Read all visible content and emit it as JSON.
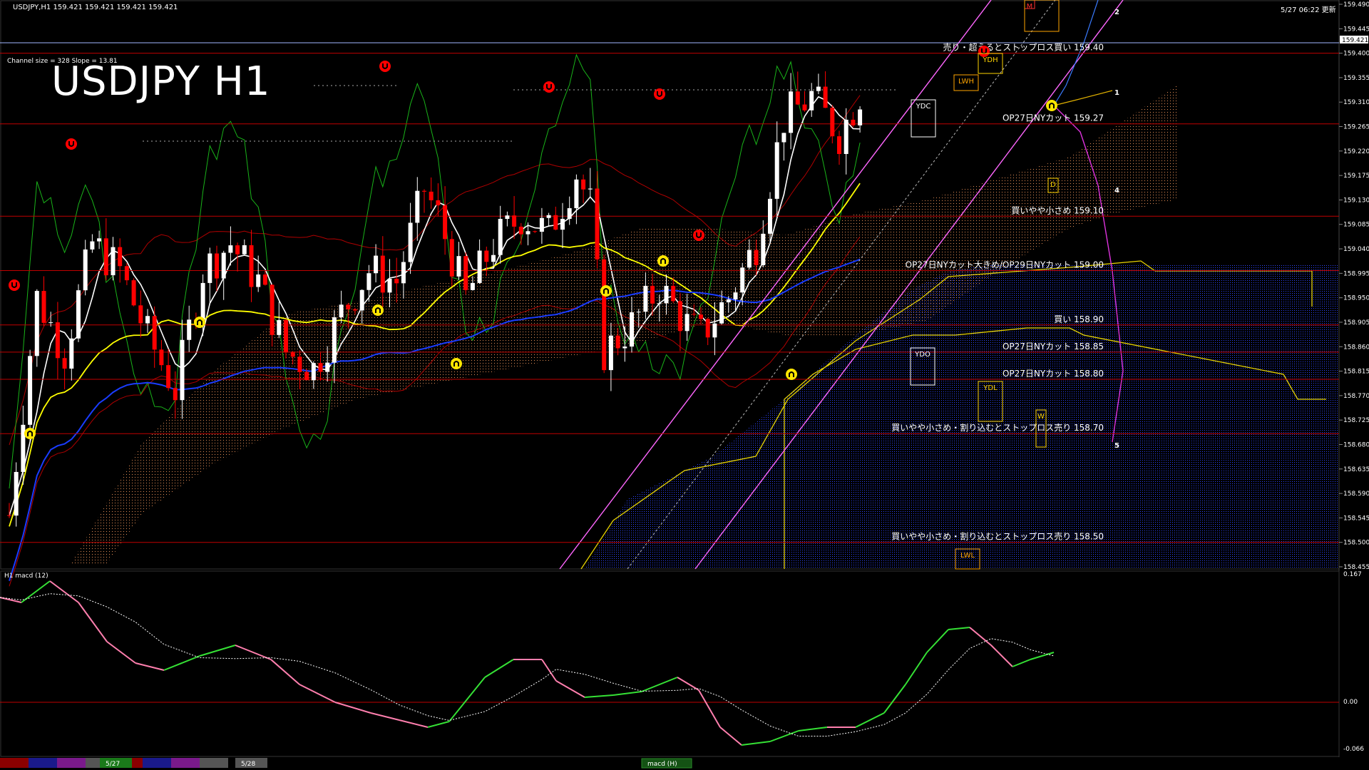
{
  "header": {
    "symbol_info": "USDJPY,H1  159.421 159.421 159.421 159.421",
    "channel_info": "Channel size = 328 Slope = 13.81",
    "big_title": "USDJPY H1",
    "datetime": "5/27 06:22 更新"
  },
  "macd_panel": {
    "label": "H1  macd (12)",
    "top": "0.167",
    "zero": "0.00",
    "bottom": "-0.066",
    "tab": "macd (H)"
  },
  "current_price": "159.421",
  "price_axis": {
    "ticks": [
      "159.490",
      "159.445",
      "159.400",
      "159.355",
      "159.310",
      "159.265",
      "159.220",
      "159.175",
      "159.130",
      "159.085",
      "159.040",
      "158.995",
      "158.950",
      "158.905",
      "158.860",
      "158.815",
      "158.770",
      "158.725",
      "158.680",
      "158.635",
      "158.590",
      "158.545",
      "158.500",
      "158.455"
    ]
  },
  "levels": [
    {
      "price": 159.4,
      "text": "売り・超えるとストップロス買い 159.40"
    },
    {
      "price": 159.27,
      "text": "OP27日NYカット 159.27"
    },
    {
      "price": 159.1,
      "text": "買いやや小さめ 159.10"
    },
    {
      "price": 159.0,
      "text": "OP27日NYカット大きめ/OP29日NYカット 159.00"
    },
    {
      "price": 158.9,
      "text": "買い 158.90"
    },
    {
      "price": 158.85,
      "text": "OP27日NYカット 158.85"
    },
    {
      "price": 158.8,
      "text": "OP27日NYカット 158.80"
    },
    {
      "price": 158.7,
      "text": "買いやや小さめ・割り込むとストップロス売り 158.70"
    },
    {
      "price": 158.5,
      "text": "買いやや小さめ・割り込むとストップロス売り 158.50"
    }
  ],
  "box_labels": [
    {
      "text": "YDH",
      "color": "#ffd400"
    },
    {
      "text": "LWH",
      "color": "#ffa500"
    },
    {
      "text": "YDC",
      "color": "#ffffff"
    },
    {
      "text": "YDO",
      "color": "#ffffff"
    },
    {
      "text": "YDL",
      "color": "#ffd400"
    },
    {
      "text": "LWL",
      "color": "#ffa500"
    },
    {
      "text": "W",
      "color": "#ffd400"
    },
    {
      "text": "D",
      "color": "#ffd400"
    },
    {
      "text": "M",
      "color": "#ff3030"
    }
  ],
  "wave_labels": [
    "1",
    "2",
    "4",
    "5"
  ],
  "date_tabs": [
    {
      "text": "5/27",
      "color": "#1a7a1a"
    },
    {
      "text": "5/28",
      "color": "#555555"
    }
  ],
  "colors": {
    "level_line": "#c00000",
    "candle_up": "#ffffff",
    "candle_down": "#ff0000",
    "kumo_up": "#ffa060",
    "kumo_down": "#3050ff",
    "ma_white": "#ffffff",
    "ma_yellow": "#ffff00",
    "ma_blue": "#1a3cff",
    "channel": "#ff66ff"
  }
}
